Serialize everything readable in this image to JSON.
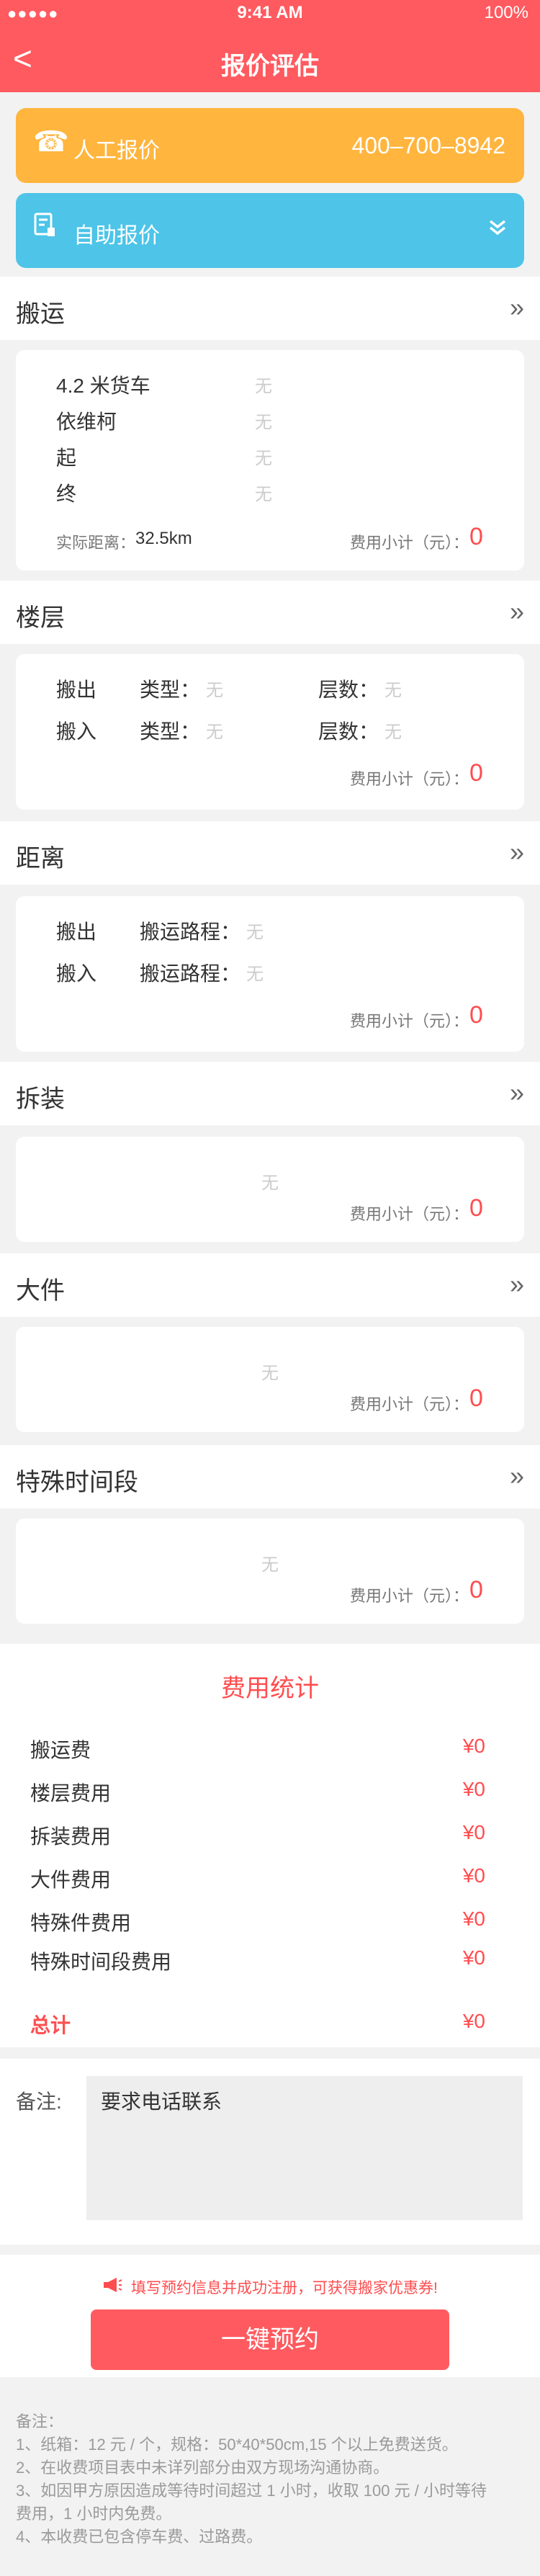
{
  "status": {
    "signal": "●●●●● ",
    "time": "9:41 AM",
    "battery": "100%"
  },
  "nav": {
    "back_icon": "<",
    "title": "报价评估"
  },
  "banners": {
    "manual": {
      "label": "人工报价",
      "phone": "400–700–8942",
      "color": "#ffb53e"
    },
    "self": {
      "label": "自助报价",
      "color": "#4dc4e8"
    }
  },
  "sections": {
    "move": {
      "title": "搬运",
      "rows": [
        {
          "label": "4.2 米货车",
          "value": "无"
        },
        {
          "label": "依维柯",
          "value": "无"
        },
        {
          "label": "起",
          "value": "无"
        },
        {
          "label": "终",
          "value": "无"
        }
      ],
      "distance_label": "实际距离：",
      "distance_value": "32.5km",
      "subtotal_label": "费用小计（元）：",
      "subtotal_value": "0"
    },
    "floor": {
      "title": "楼层",
      "rows": [
        {
          "label": "搬出",
          "type_label": "类型：",
          "type_value": "无",
          "floors_label": "层数：",
          "floors_value": "无"
        },
        {
          "label": "搬入",
          "type_label": "类型：",
          "type_value": "无",
          "floors_label": "层数：",
          "floors_value": "无"
        }
      ],
      "subtotal_label": "费用小计（元）：",
      "subtotal_value": "0"
    },
    "distance": {
      "title": "距离",
      "rows": [
        {
          "label": "搬出",
          "route_label": "搬运路程：",
          "route_value": "无"
        },
        {
          "label": "搬入",
          "route_label": "搬运路程：",
          "route_value": "无"
        }
      ],
      "subtotal_label": "费用小计（元）：",
      "subtotal_value": "0"
    },
    "assembly": {
      "title": "拆装",
      "empty": "无",
      "subtotal_label": "费用小计（元）：",
      "subtotal_value": "0"
    },
    "large": {
      "title": "大件",
      "empty": "无",
      "subtotal_label": "费用小计（元）：",
      "subtotal_value": "0"
    },
    "special_time": {
      "title": "特殊时间段",
      "empty": "无",
      "subtotal_label": "费用小计（元）：",
      "subtotal_value": "0"
    }
  },
  "stats": {
    "title": "费用统计",
    "items": [
      {
        "label": "搬运费",
        "value": "¥0"
      },
      {
        "label": "楼层费用",
        "value": "¥0"
      },
      {
        "label": "拆装费用",
        "value": "¥0"
      },
      {
        "label": "大件费用",
        "value": "¥0"
      },
      {
        "label": "特殊件费用",
        "value": "¥0"
      },
      {
        "label": "特殊时间段费用",
        "value": "¥0"
      }
    ],
    "total_label": "总计",
    "total_value": "¥0"
  },
  "notes": {
    "label": "备注:",
    "value": "要求电话联系"
  },
  "cta": {
    "tip": "填写预约信息并成功注册，可获得搬家优惠券!",
    "button": "一键预约"
  },
  "footer": {
    "lines": [
      "备注：",
      "1、纸箱：12 元 / 个，规格：50*40*50cm,15 个以上免费送货。",
      "2、在收费项目表中未详列部分由双方现场沟通协商。",
      "3、如因甲方原因造成等待时间超过 1 小时，收取 100 元 / 小时等待",
      "费用，1 小时内免费。",
      "4、本收费已包含停车费、过路费。"
    ]
  },
  "colors": {
    "accent": "#ff5a5f",
    "orange": "#ffb53e",
    "blue": "#4dc4e8"
  }
}
